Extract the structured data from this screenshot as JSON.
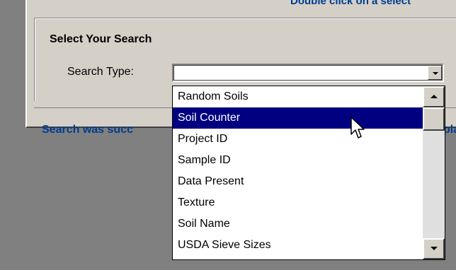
{
  "header": {
    "partial_link": "Double click on a select"
  },
  "search_group": {
    "title": "Select Your Search",
    "search_type_label": "Search Type:",
    "search_type_value": ""
  },
  "status": {
    "text_left": "Search was succ",
    "text_right": "pla"
  },
  "dropdown": {
    "options": [
      "Random Soils",
      "Soil Counter",
      "Project ID",
      "Sample ID",
      "Data Present",
      "Texture",
      "Soil Name",
      "USDA Sieve Sizes"
    ],
    "selected": "Soil Counter"
  },
  "colors": {
    "selection": "#000080",
    "link": "#003d8f",
    "face": "#d4d0c8",
    "backdrop": "#808080"
  },
  "icons": [
    "chevron-down-icon",
    "scroll-up-icon",
    "scroll-down-icon",
    "mouse-cursor-icon"
  ]
}
